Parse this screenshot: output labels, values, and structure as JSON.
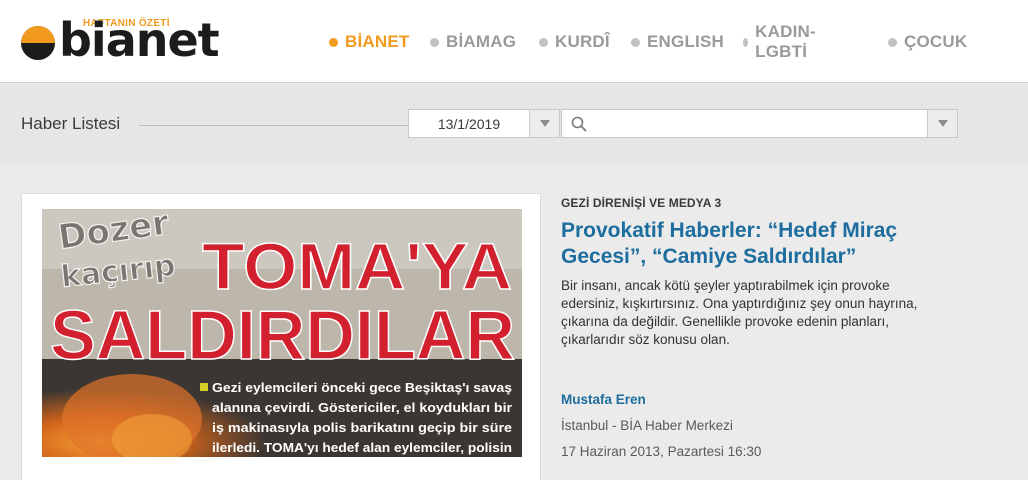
{
  "logo": {
    "name": "bianet",
    "tagline": "HAFTANIN ÖZETİ"
  },
  "nav": {
    "items": [
      {
        "label": "BİANET",
        "active": true
      },
      {
        "label": "BİAMAG",
        "active": false
      },
      {
        "label": "KURDÎ",
        "active": false
      },
      {
        "label": "ENGLISH",
        "active": false
      },
      {
        "label": "KADIN-LGBTİ",
        "active": false
      },
      {
        "label": "ÇOCUK",
        "active": false
      }
    ]
  },
  "filter": {
    "title": "Haber Listesi",
    "date_value": "13/1/2019",
    "search_value": ""
  },
  "article": {
    "photo": {
      "headline_top": "Dozer",
      "headline_mid": "kaçırıp",
      "headline_big1": "TOMA'YA",
      "headline_big2": "SALDIRDILAR",
      "body_lines": [
        "Gezi eylemcileri önceki gece Beşiktaş'ı savaş",
        "alanına çevirdi. Göstericiler, el koydukları bir",
        "iş makinasıyla polis barikatını geçip bir süre",
        "ilerledi. TOMA'yı hedef alan eylemciler, polisin"
      ]
    },
    "category": "GEZİ DİRENİŞİ VE MEDYA 3",
    "headline": "Provokatif Haberler: “Hedef Miraç Gecesi”, “Camiye Saldırdılar”",
    "summary": "Bir insanı, ancak kötü şeyler yaptırabilmek için provoke edersiniz, kışkırtırsınız. Ona yaptırdığınız şey onun hayrına, çıkarına da değildir. Genellikle provoke edenin planları, çıkarlarıdır söz konusu olan.",
    "author": "Mustafa Eren",
    "source": "İstanbul - BİA Haber Merkezi",
    "date": "17 Haziran 2013, Pazartesi 16:30"
  },
  "colors": {
    "accent": "#f29a1d",
    "link": "#1d6d9e",
    "nav_inactive": "#9a9a9a",
    "newspaper_red": "#d2202f"
  }
}
